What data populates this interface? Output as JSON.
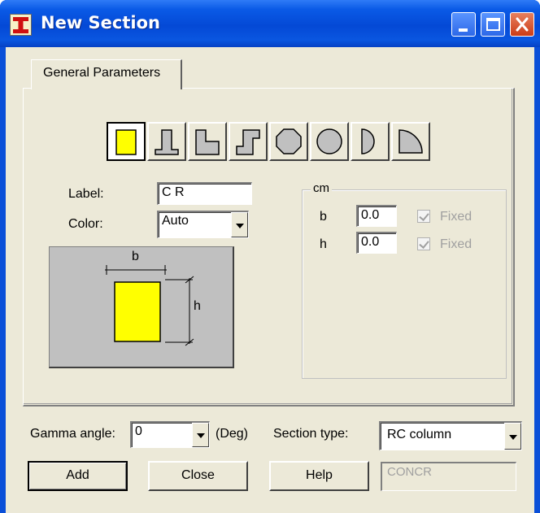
{
  "window": {
    "title": "New Section",
    "app_icon": "section-i-beam-icon"
  },
  "tabs": [
    {
      "label": "General Parameters",
      "active": true
    }
  ],
  "shapes": [
    {
      "name": "rectangle",
      "active": true
    },
    {
      "name": "t-section",
      "active": false
    },
    {
      "name": "l-section",
      "active": false
    },
    {
      "name": "z-section",
      "active": false
    },
    {
      "name": "octagon",
      "active": false
    },
    {
      "name": "circle",
      "active": false
    },
    {
      "name": "half-circle",
      "active": false
    },
    {
      "name": "quarter-circle",
      "active": false
    }
  ],
  "form": {
    "label_label": "Label:",
    "label_value": "C R",
    "color_label": "Color:",
    "color_value": "Auto"
  },
  "preview": {
    "b_label": "b",
    "h_label": "h",
    "fill_color": "#ffff00"
  },
  "dimensions": {
    "unit": "cm",
    "b_label": "b",
    "b_value": "0.0",
    "b_fixed_label": "Fixed",
    "b_fixed_checked": true,
    "h_label": "h",
    "h_value": "0.0",
    "h_fixed_label": "Fixed",
    "h_fixed_checked": true
  },
  "bottom": {
    "gamma_label": "Gamma angle:",
    "gamma_value": "0",
    "gamma_unit": "(Deg)",
    "section_type_label": "Section type:",
    "section_type_value": "RC column"
  },
  "buttons": {
    "add": "Add",
    "close": "Close",
    "help": "Help"
  },
  "material": {
    "value": "CONCR"
  }
}
